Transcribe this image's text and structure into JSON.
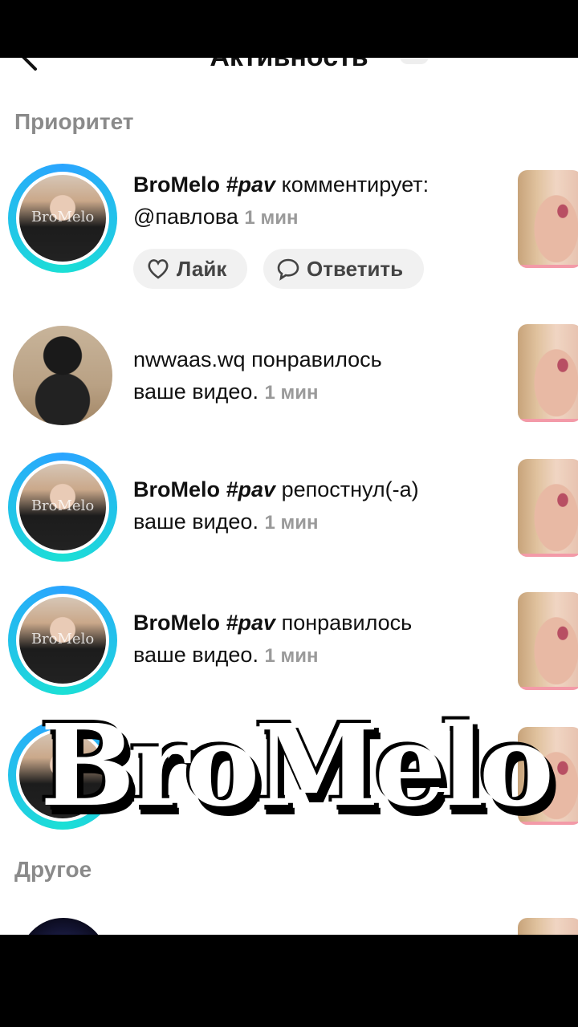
{
  "header": {
    "title": "Активность"
  },
  "sections": {
    "priority": "Приоритет",
    "other": "Другое"
  },
  "rows": [
    {
      "user": "BroMelo",
      "tag": "#pav",
      "action": "комментирует:",
      "line2": "@павлова",
      "time": "1 мин",
      "avatar_watermark": "BroMelo",
      "buttons": {
        "like": "Лайк",
        "reply": "Ответить"
      }
    },
    {
      "user": "nwwaas.wq",
      "action": "понравилось",
      "line2": "ваше видео.",
      "time": "1 мин"
    },
    {
      "user": "BroMelo",
      "tag": "#pav",
      "action": "репостнул(-а)",
      "line2": "ваше видео.",
      "time": "1 мин",
      "avatar_watermark": "BroMelo"
    },
    {
      "user": "BroMelo",
      "tag": "#pav",
      "action": "понравилось",
      "line2": "ваше видео.",
      "time": "1 мин",
      "avatar_watermark": "BroMelo"
    }
  ],
  "overlay": {
    "logo_text": "BroMelo"
  },
  "colors": {
    "ring_start": "#2aa4ff",
    "ring_end": "#1be0d5",
    "muted": "#9a9a9a"
  }
}
